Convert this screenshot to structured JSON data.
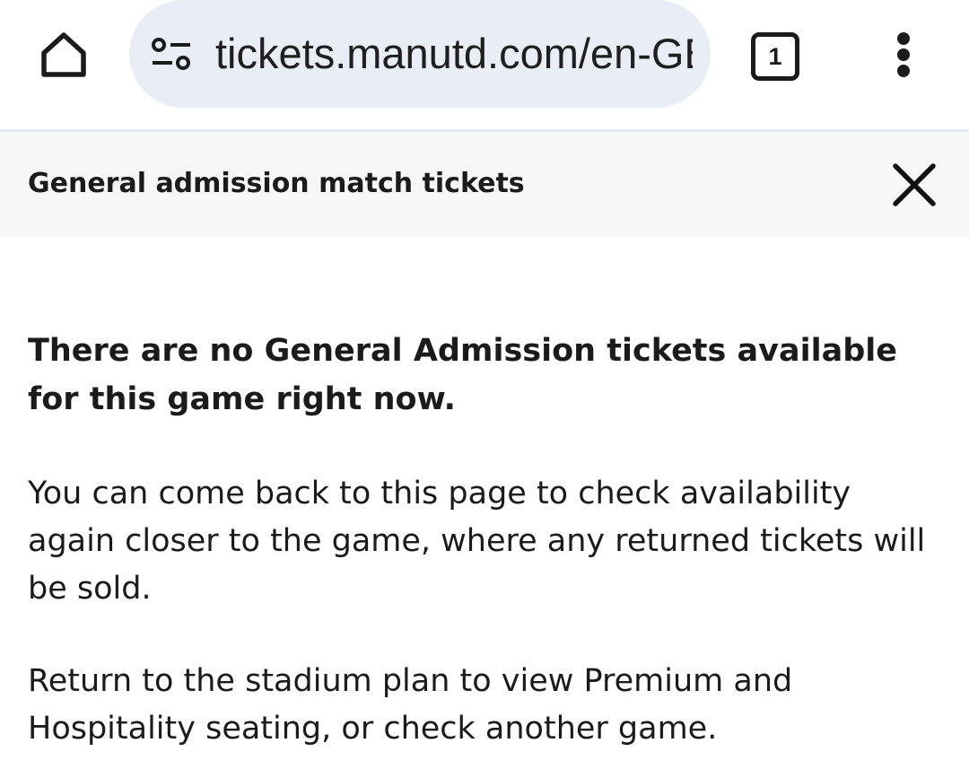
{
  "browser": {
    "url": "tickets.manutd.com/en-GB",
    "tab_count": "1",
    "icons": {
      "home": "home-icon",
      "site_info": "tune-icon",
      "tabs": "tab-switcher-icon",
      "menu": "more-vert-icon"
    }
  },
  "panel": {
    "title": "General admission match tickets",
    "close_icon": "close-icon"
  },
  "message": {
    "headline": "There are no General Admission tickets available for this game right now.",
    "paragraph1": "You can come back to this page to check availability again closer to the game, where any returned tickets will be sold.",
    "paragraph2": "Return to the stadium plan to view Premium and Hospitality seating, or check another game."
  }
}
